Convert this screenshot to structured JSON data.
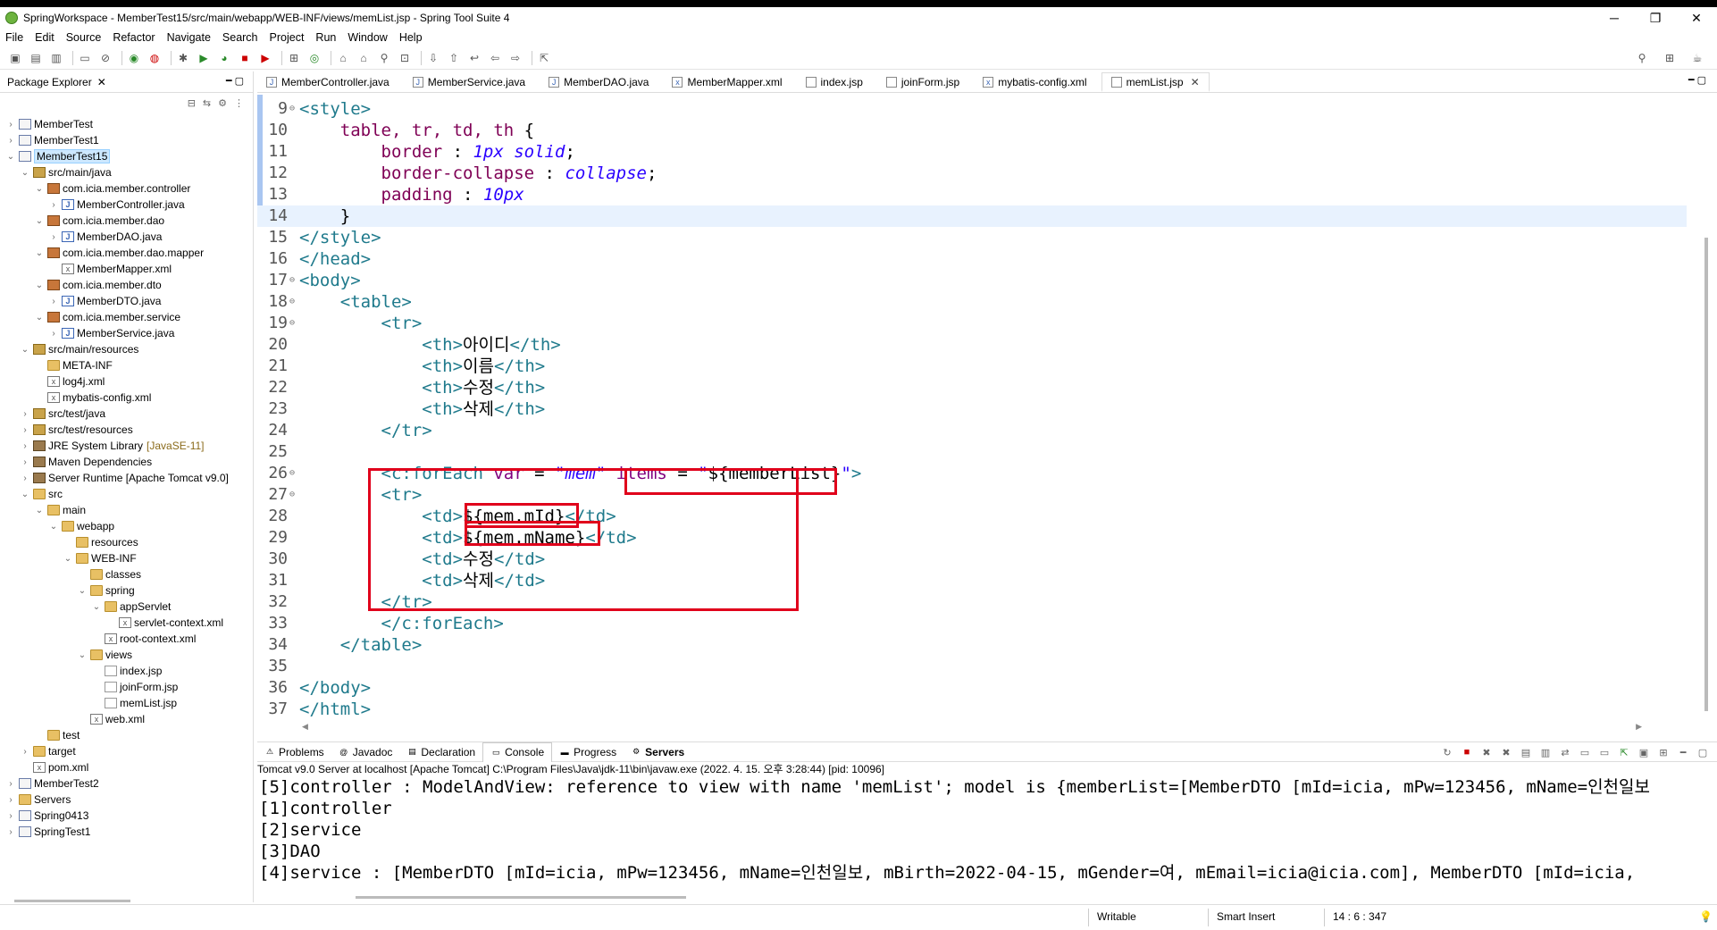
{
  "window": {
    "title": "SpringWorkspace - MemberTest15/src/main/webapp/WEB-INF/views/memList.jsp - Spring Tool Suite 4",
    "controls": [
      "─",
      "❐",
      "✕"
    ]
  },
  "menu": [
    "File",
    "Edit",
    "Source",
    "Refactor",
    "Navigate",
    "Search",
    "Project",
    "Run",
    "Window",
    "Help"
  ],
  "package_explorer": {
    "title": "Package Explorer",
    "tree": [
      {
        "label": "MemberTest",
        "depth": 0,
        "twisty": ">",
        "icon": "project"
      },
      {
        "label": "MemberTest1",
        "depth": 0,
        "twisty": ">",
        "icon": "project"
      },
      {
        "label": "MemberTest15",
        "depth": 0,
        "twisty": "v",
        "icon": "project",
        "selected": true
      },
      {
        "label": "src/main/java",
        "depth": 1,
        "twisty": "v",
        "icon": "srcf"
      },
      {
        "label": "com.icia.member.controller",
        "depth": 2,
        "twisty": "v",
        "icon": "pkg"
      },
      {
        "label": "MemberController.java",
        "depth": 3,
        "twisty": ">",
        "icon": "java"
      },
      {
        "label": "com.icia.member.dao",
        "depth": 2,
        "twisty": "v",
        "icon": "pkg"
      },
      {
        "label": "MemberDAO.java",
        "depth": 3,
        "twisty": ">",
        "icon": "java"
      },
      {
        "label": "com.icia.member.dao.mapper",
        "depth": 2,
        "twisty": "v",
        "icon": "pkg"
      },
      {
        "label": "MemberMapper.xml",
        "depth": 3,
        "twisty": "",
        "icon": "xml"
      },
      {
        "label": "com.icia.member.dto",
        "depth": 2,
        "twisty": "v",
        "icon": "pkg"
      },
      {
        "label": "MemberDTO.java",
        "depth": 3,
        "twisty": ">",
        "icon": "java"
      },
      {
        "label": "com.icia.member.service",
        "depth": 2,
        "twisty": "v",
        "icon": "pkg"
      },
      {
        "label": "MemberService.java",
        "depth": 3,
        "twisty": ">",
        "icon": "java"
      },
      {
        "label": "src/main/resources",
        "depth": 1,
        "twisty": "v",
        "icon": "srcf"
      },
      {
        "label": "META-INF",
        "depth": 2,
        "twisty": "",
        "icon": "folder"
      },
      {
        "label": "log4j.xml",
        "depth": 2,
        "twisty": "",
        "icon": "xml"
      },
      {
        "label": "mybatis-config.xml",
        "depth": 2,
        "twisty": "",
        "icon": "xml"
      },
      {
        "label": "src/test/java",
        "depth": 1,
        "twisty": ">",
        "icon": "srcf"
      },
      {
        "label": "src/test/resources",
        "depth": 1,
        "twisty": ">",
        "icon": "srcf"
      },
      {
        "label": "JRE System Library",
        "suffix": "[JavaSE-11]",
        "depth": 1,
        "twisty": ">",
        "icon": "lib"
      },
      {
        "label": "Maven Dependencies",
        "depth": 1,
        "twisty": ">",
        "icon": "lib"
      },
      {
        "label": "Server Runtime [Apache Tomcat v9.0]",
        "depth": 1,
        "twisty": ">",
        "icon": "lib"
      },
      {
        "label": "src",
        "depth": 1,
        "twisty": "v",
        "icon": "folder"
      },
      {
        "label": "main",
        "depth": 2,
        "twisty": "v",
        "icon": "folder"
      },
      {
        "label": "webapp",
        "depth": 3,
        "twisty": "v",
        "icon": "folder"
      },
      {
        "label": "resources",
        "depth": 4,
        "twisty": "",
        "icon": "folder"
      },
      {
        "label": "WEB-INF",
        "depth": 4,
        "twisty": "v",
        "icon": "folder"
      },
      {
        "label": "classes",
        "depth": 5,
        "twisty": "",
        "icon": "folder"
      },
      {
        "label": "spring",
        "depth": 5,
        "twisty": "v",
        "icon": "folder"
      },
      {
        "label": "appServlet",
        "depth": 6,
        "twisty": "v",
        "icon": "folder"
      },
      {
        "label": "servlet-context.xml",
        "depth": 7,
        "twisty": "",
        "icon": "xml"
      },
      {
        "label": "root-context.xml",
        "depth": 6,
        "twisty": "",
        "icon": "xml"
      },
      {
        "label": "views",
        "depth": 5,
        "twisty": "v",
        "icon": "folder"
      },
      {
        "label": "index.jsp",
        "depth": 6,
        "twisty": "",
        "icon": "jsp"
      },
      {
        "label": "joinForm.jsp",
        "depth": 6,
        "twisty": "",
        "icon": "jsp"
      },
      {
        "label": "memList.jsp",
        "depth": 6,
        "twisty": "",
        "icon": "jsp"
      },
      {
        "label": "web.xml",
        "depth": 5,
        "twisty": "",
        "icon": "xml"
      },
      {
        "label": "test",
        "depth": 2,
        "twisty": "",
        "icon": "folder"
      },
      {
        "label": "target",
        "depth": 1,
        "twisty": ">",
        "icon": "folder"
      },
      {
        "label": "pom.xml",
        "depth": 1,
        "twisty": "",
        "icon": "xml"
      },
      {
        "label": "MemberTest2",
        "depth": 0,
        "twisty": ">",
        "icon": "project"
      },
      {
        "label": "Servers",
        "depth": 0,
        "twisty": ">",
        "icon": "folder"
      },
      {
        "label": "Spring0413",
        "depth": 0,
        "twisty": ">",
        "icon": "project"
      },
      {
        "label": "SpringTest1",
        "depth": 0,
        "twisty": ">",
        "icon": "project"
      }
    ]
  },
  "editor": {
    "tabs": [
      {
        "label": "MemberController.java",
        "icon": "J"
      },
      {
        "label": "MemberService.java",
        "icon": "J"
      },
      {
        "label": "MemberDAO.java",
        "icon": "J"
      },
      {
        "label": "MemberMapper.xml",
        "icon": "x"
      },
      {
        "label": "index.jsp",
        "icon": ""
      },
      {
        "label": "joinForm.jsp",
        "icon": ""
      },
      {
        "label": "mybatis-config.xml",
        "icon": "x"
      },
      {
        "label": "memList.jsp",
        "icon": "",
        "active": true
      }
    ],
    "lines": [
      {
        "n": "9",
        "fold": "⊖",
        "parts": [
          [
            "t-tag",
            "<style>"
          ]
        ]
      },
      {
        "n": "10",
        "fold": "",
        "parts": [
          [
            "t-el",
            "    "
          ],
          [
            "t-prop",
            "table, tr, td, th"
          ],
          [
            "t-el",
            " {"
          ]
        ]
      },
      {
        "n": "11",
        "fold": "",
        "parts": [
          [
            "t-el",
            "        "
          ],
          [
            "t-prop",
            "border"
          ],
          [
            "t-el",
            " : "
          ],
          [
            "t-val",
            "1px solid"
          ],
          [
            "t-el",
            ";"
          ]
        ]
      },
      {
        "n": "12",
        "fold": "",
        "parts": [
          [
            "t-el",
            "        "
          ],
          [
            "t-prop",
            "border-collapse"
          ],
          [
            "t-el",
            " : "
          ],
          [
            "t-val",
            "collapse"
          ],
          [
            "t-el",
            ";"
          ]
        ]
      },
      {
        "n": "13",
        "fold": "",
        "parts": [
          [
            "t-el",
            "        "
          ],
          [
            "t-prop",
            "padding"
          ],
          [
            "t-el",
            " : "
          ],
          [
            "t-val",
            "10px"
          ]
        ]
      },
      {
        "n": "14",
        "fold": "",
        "current": true,
        "parts": [
          [
            "t-el",
            "    }"
          ]
        ]
      },
      {
        "n": "15",
        "fold": "",
        "parts": [
          [
            "t-tag",
            "</style>"
          ]
        ]
      },
      {
        "n": "16",
        "fold": "",
        "parts": [
          [
            "t-tag",
            "</head>"
          ]
        ]
      },
      {
        "n": "17",
        "fold": "⊖",
        "parts": [
          [
            "t-tag",
            "<body>"
          ]
        ]
      },
      {
        "n": "18",
        "fold": "⊖",
        "parts": [
          [
            "t-el",
            "    "
          ],
          [
            "t-tag",
            "<table>"
          ]
        ]
      },
      {
        "n": "19",
        "fold": "⊖",
        "parts": [
          [
            "t-el",
            "        "
          ],
          [
            "t-tag",
            "<tr>"
          ]
        ]
      },
      {
        "n": "20",
        "fold": "",
        "parts": [
          [
            "t-el",
            "            "
          ],
          [
            "t-tag",
            "<th>"
          ],
          [
            "t-el",
            "아이디"
          ],
          [
            "t-tag",
            "</th>"
          ]
        ]
      },
      {
        "n": "21",
        "fold": "",
        "parts": [
          [
            "t-el",
            "            "
          ],
          [
            "t-tag",
            "<th>"
          ],
          [
            "t-el",
            "이름"
          ],
          [
            "t-tag",
            "</th>"
          ]
        ]
      },
      {
        "n": "22",
        "fold": "",
        "parts": [
          [
            "t-el",
            "            "
          ],
          [
            "t-tag",
            "<th>"
          ],
          [
            "t-el",
            "수정"
          ],
          [
            "t-tag",
            "</th>"
          ]
        ]
      },
      {
        "n": "23",
        "fold": "",
        "parts": [
          [
            "t-el",
            "            "
          ],
          [
            "t-tag",
            "<th>"
          ],
          [
            "t-el",
            "삭제"
          ],
          [
            "t-tag",
            "</th>"
          ]
        ]
      },
      {
        "n": "24",
        "fold": "",
        "parts": [
          [
            "t-el",
            "        "
          ],
          [
            "t-tag",
            "</tr>"
          ]
        ]
      },
      {
        "n": "25",
        "fold": "",
        "parts": [
          [
            "t-el",
            ""
          ]
        ]
      },
      {
        "n": "26",
        "fold": "⊖",
        "parts": [
          [
            "t-el",
            "        "
          ],
          [
            "t-tag",
            "<c:forEach "
          ],
          [
            "t-attr",
            "var"
          ],
          [
            "t-el",
            " = "
          ],
          [
            "t-str",
            "\"mem\""
          ],
          [
            "t-el",
            " "
          ],
          [
            "t-attr",
            "items"
          ],
          [
            "t-el",
            " = "
          ],
          [
            "t-str",
            "\""
          ],
          [
            "t-el",
            "${memberList}"
          ],
          [
            "t-str",
            "\""
          ],
          [
            "t-tag",
            ">"
          ]
        ]
      },
      {
        "n": "27",
        "fold": "⊖",
        "parts": [
          [
            "t-el",
            "        "
          ],
          [
            "t-tag",
            "<tr>"
          ]
        ]
      },
      {
        "n": "28",
        "fold": "",
        "parts": [
          [
            "t-el",
            "            "
          ],
          [
            "t-tag",
            "<td>"
          ],
          [
            "t-el",
            "${mem.mId}"
          ],
          [
            "t-tag",
            "</td>"
          ]
        ]
      },
      {
        "n": "29",
        "fold": "",
        "parts": [
          [
            "t-el",
            "            "
          ],
          [
            "t-tag",
            "<td>"
          ],
          [
            "t-el",
            "${mem.mName}"
          ],
          [
            "t-tag",
            "</td>"
          ]
        ]
      },
      {
        "n": "30",
        "fold": "",
        "parts": [
          [
            "t-el",
            "            "
          ],
          [
            "t-tag",
            "<td>"
          ],
          [
            "t-el",
            "수정"
          ],
          [
            "t-tag",
            "</td>"
          ]
        ]
      },
      {
        "n": "31",
        "fold": "",
        "parts": [
          [
            "t-el",
            "            "
          ],
          [
            "t-tag",
            "<td>"
          ],
          [
            "t-el",
            "삭제"
          ],
          [
            "t-tag",
            "</td>"
          ]
        ]
      },
      {
        "n": "32",
        "fold": "",
        "parts": [
          [
            "t-el",
            "        "
          ],
          [
            "t-tag",
            "</tr>"
          ]
        ]
      },
      {
        "n": "33",
        "fold": "",
        "parts": [
          [
            "t-el",
            "        "
          ],
          [
            "t-tag",
            "</c:forEach>"
          ]
        ]
      },
      {
        "n": "34",
        "fold": "",
        "parts": [
          [
            "t-el",
            "    "
          ],
          [
            "t-tag",
            "</table>"
          ]
        ]
      },
      {
        "n": "35",
        "fold": "",
        "parts": [
          [
            "t-el",
            ""
          ]
        ]
      },
      {
        "n": "36",
        "fold": "",
        "parts": [
          [
            "t-tag",
            "</body>"
          ]
        ]
      },
      {
        "n": "37",
        "fold": "",
        "parts": [
          [
            "t-tag",
            "</html>"
          ]
        ]
      }
    ]
  },
  "bottom_panel": {
    "tabs": [
      {
        "label": "Problems",
        "icon": "⚠"
      },
      {
        "label": "Javadoc",
        "icon": "@"
      },
      {
        "label": "Declaration",
        "icon": "▤"
      },
      {
        "label": "Console",
        "icon": "▭",
        "active": true
      },
      {
        "label": "Progress",
        "icon": "▬"
      },
      {
        "label": "Servers",
        "icon": "⚙",
        "bold": true
      }
    ],
    "console_title": "Tomcat v9.0 Server at localhost [Apache Tomcat] C:\\Program Files\\Java\\jdk-11\\bin\\javaw.exe  (2022. 4. 15. 오후 3:28:44) [pid: 10096]",
    "console_lines": [
      "[5]controller : ModelAndView: reference to view with name 'memList'; model is {memberList=[MemberDTO [mId=icia, mPw=123456, mName=인천일보",
      "[1]controller",
      "[2]service",
      "[3]DAO",
      "[4]service : [MemberDTO [mId=icia, mPw=123456, mName=인천일보, mBirth=2022-04-15, mGender=여, mEmail=icia@icia.com], MemberDTO [mId=icia,"
    ]
  },
  "status": {
    "writable": "Writable",
    "insert_mode": "Smart Insert",
    "position": "14 : 6 : 347"
  }
}
